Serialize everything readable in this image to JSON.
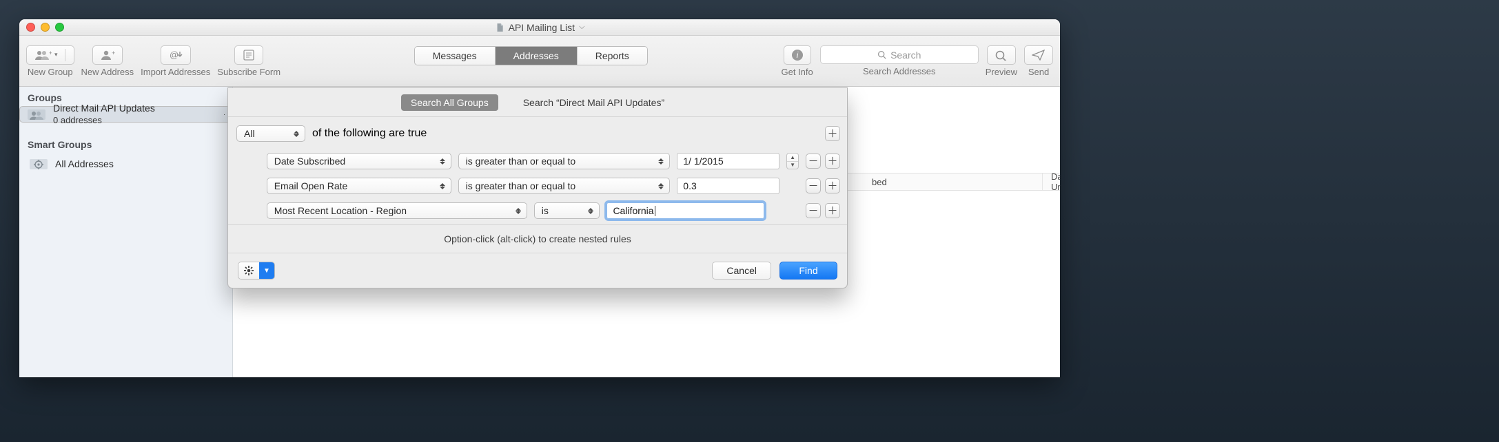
{
  "window": {
    "title": "API Mailing List"
  },
  "toolbar": {
    "new_group": "New Group",
    "new_address": "New Address",
    "import_addresses": "Import Addresses",
    "subscribe_form": "Subscribe Form",
    "get_info": "Get Info",
    "search_addresses": "Search Addresses",
    "search_placeholder": "Search",
    "preview": "Preview",
    "send": "Send",
    "tabs": {
      "messages": "Messages",
      "addresses": "Addresses",
      "reports": "Reports",
      "active": "addresses"
    }
  },
  "sidebar": {
    "groups_header": "Groups",
    "smart_header": "Smart Groups",
    "group": {
      "name": "Direct Mail API Updates",
      "count_label": "0 addresses"
    },
    "all_addresses": "All Addresses"
  },
  "columns": {
    "date_subscribed": "bed",
    "date_unsubscribed": "Date Unsubscribed"
  },
  "sheet": {
    "scope_all": "Search All Groups",
    "scope_group": "Search “Direct Mail API Updates”",
    "match_qualifier": "All",
    "match_tail": "of the following are true",
    "rules": [
      {
        "field": "Date Subscribed",
        "op": "is greater than or equal to",
        "value": "1/  1/2015",
        "value_type": "date"
      },
      {
        "field": "Email Open Rate",
        "op": "is greater than or equal to",
        "value": "0.3",
        "value_type": "number"
      },
      {
        "field": "Most Recent Location - Region",
        "op": "is",
        "value": "California",
        "value_type": "text",
        "focused": true
      }
    ],
    "hint": "Option-click (alt-click) to create nested rules",
    "cancel": "Cancel",
    "find": "Find"
  }
}
